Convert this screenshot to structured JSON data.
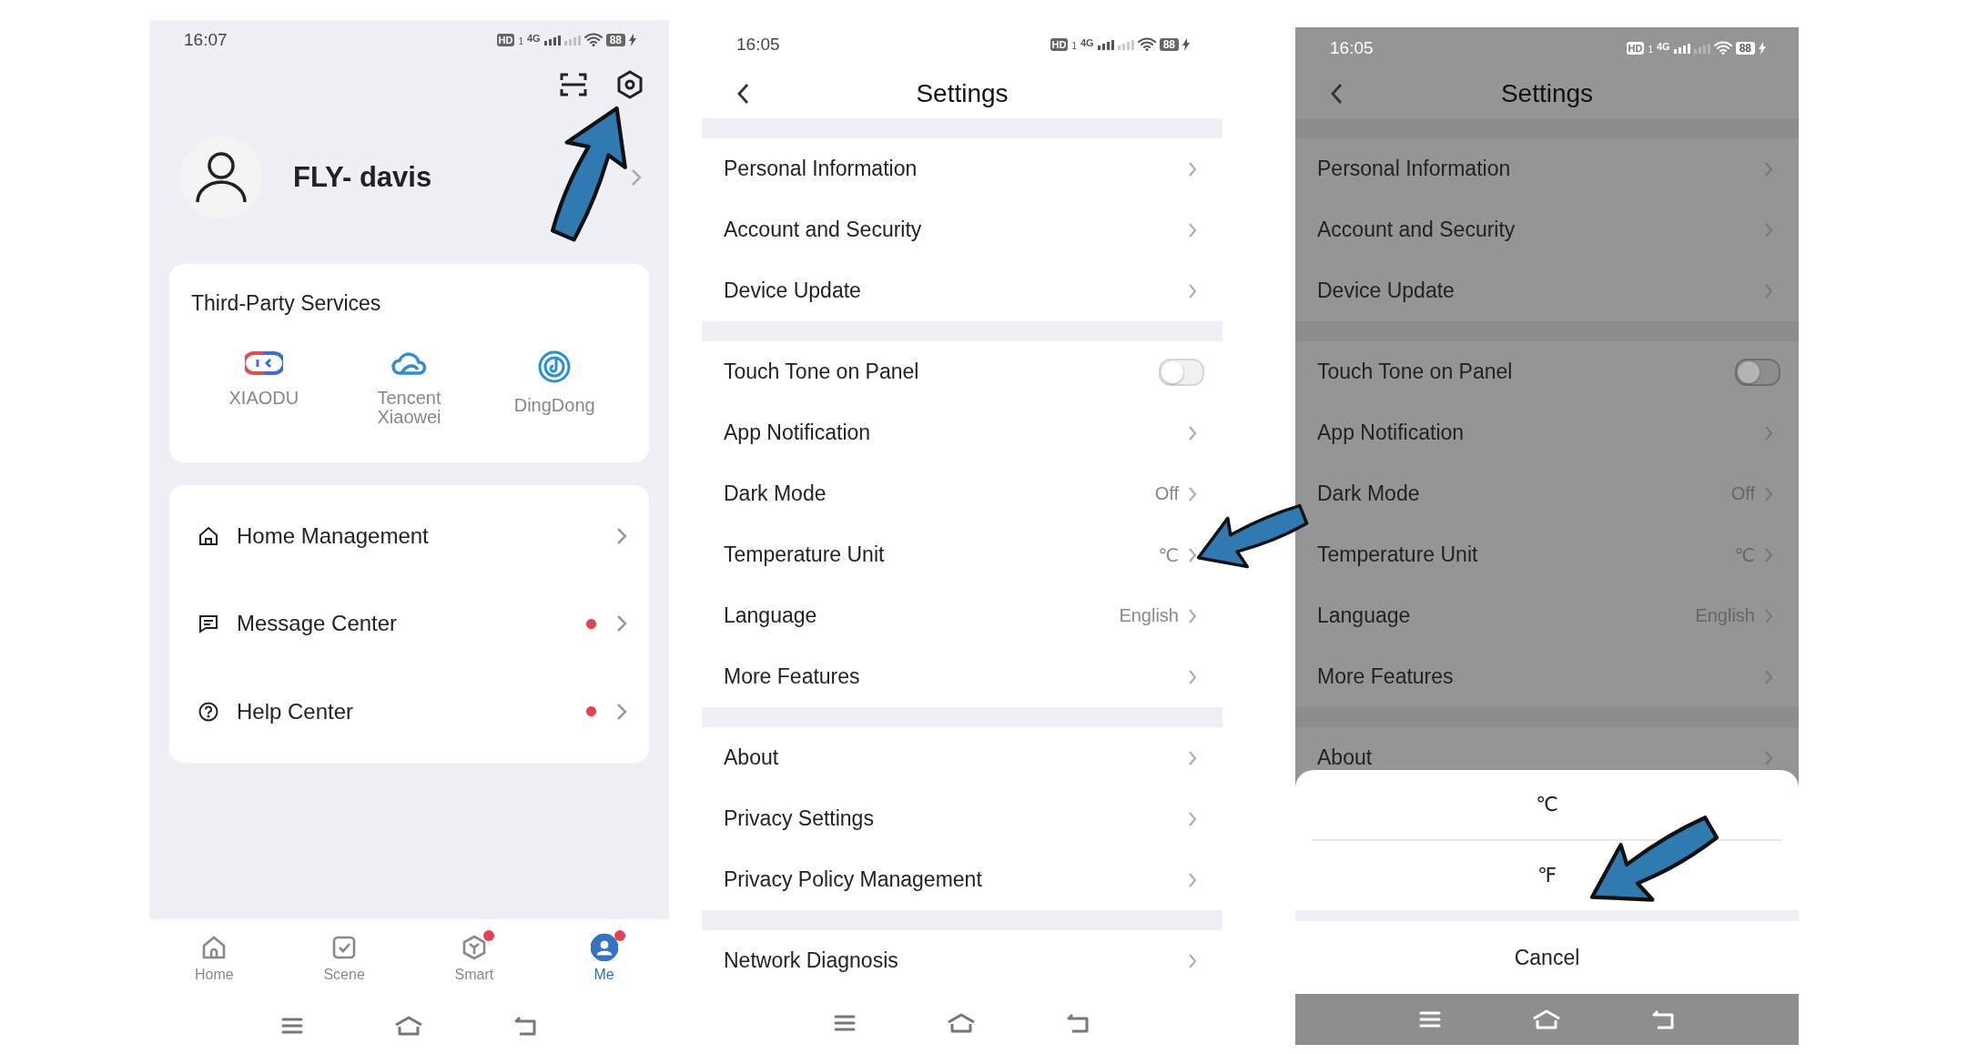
{
  "screens": [
    {
      "kind": "profile",
      "status_bar": {
        "time": "16:07",
        "hd": "HD",
        "sim": "1",
        "network": "4G",
        "battery": "88"
      },
      "user_name": "FLY- davis",
      "services": {
        "title": "Third-Party Services",
        "items": [
          {
            "label": "XIAODU"
          },
          {
            "label": "Tencent Xiaowei"
          },
          {
            "label": "DingDong"
          }
        ]
      },
      "menu": [
        {
          "label": "Home Management",
          "badge": false
        },
        {
          "label": "Message Center",
          "badge": true
        },
        {
          "label": "Help Center",
          "badge": true
        }
      ],
      "tab_bar": [
        {
          "label": "Home",
          "selected": false,
          "badge": false
        },
        {
          "label": "Scene",
          "selected": false,
          "badge": false
        },
        {
          "label": "Smart",
          "selected": false,
          "badge": true
        },
        {
          "label": "Me",
          "selected": true,
          "badge": true
        }
      ]
    },
    {
      "kind": "settings",
      "dimmed": false,
      "status_bar": {
        "time": "16:05",
        "hd": "HD",
        "sim": "1",
        "network": "4G",
        "battery": "88"
      },
      "title": "Settings",
      "groups": [
        {
          "rows": [
            {
              "kind": "link",
              "label": "Personal Information"
            },
            {
              "kind": "link",
              "label": "Account and Security"
            },
            {
              "kind": "link",
              "label": "Device Update"
            }
          ]
        },
        {
          "rows": [
            {
              "kind": "toggle",
              "label": "Touch Tone on Panel",
              "on": false
            },
            {
              "kind": "link",
              "label": "App Notification"
            },
            {
              "kind": "link",
              "label": "Dark Mode",
              "value": "Off"
            },
            {
              "kind": "link",
              "label": "Temperature Unit",
              "value": "℃"
            },
            {
              "kind": "link",
              "label": "Language",
              "value": "English"
            },
            {
              "kind": "link",
              "label": "More Features"
            }
          ]
        },
        {
          "rows": [
            {
              "kind": "link",
              "label": "About"
            },
            {
              "kind": "link",
              "label": "Privacy Settings"
            },
            {
              "kind": "link",
              "label": "Privacy Policy Management"
            }
          ]
        },
        {
          "rows": [
            {
              "kind": "link",
              "label": "Network Diagnosis"
            }
          ]
        }
      ]
    },
    {
      "kind": "settings",
      "dimmed": true,
      "status_bar": {
        "time": "16:05",
        "hd": "HD",
        "sim": "1",
        "network": "4G",
        "battery": "88"
      },
      "title": "Settings",
      "groups": [
        {
          "rows": [
            {
              "kind": "link",
              "label": "Personal Information"
            },
            {
              "kind": "link",
              "label": "Account and Security"
            },
            {
              "kind": "link",
              "label": "Device Update"
            }
          ]
        },
        {
          "rows": [
            {
              "kind": "toggle",
              "label": "Touch Tone on Panel",
              "on": false
            },
            {
              "kind": "link",
              "label": "App Notification"
            },
            {
              "kind": "link",
              "label": "Dark Mode",
              "value": "Off"
            },
            {
              "kind": "link",
              "label": "Temperature Unit",
              "value": "℃"
            },
            {
              "kind": "link",
              "label": "Language",
              "value": "English"
            },
            {
              "kind": "link",
              "label": "More Features"
            }
          ]
        },
        {
          "rows": [
            {
              "kind": "link",
              "label": "About"
            }
          ]
        }
      ],
      "sheet": {
        "options": [
          "℃",
          "℉"
        ],
        "cancel": "Cancel"
      }
    }
  ]
}
